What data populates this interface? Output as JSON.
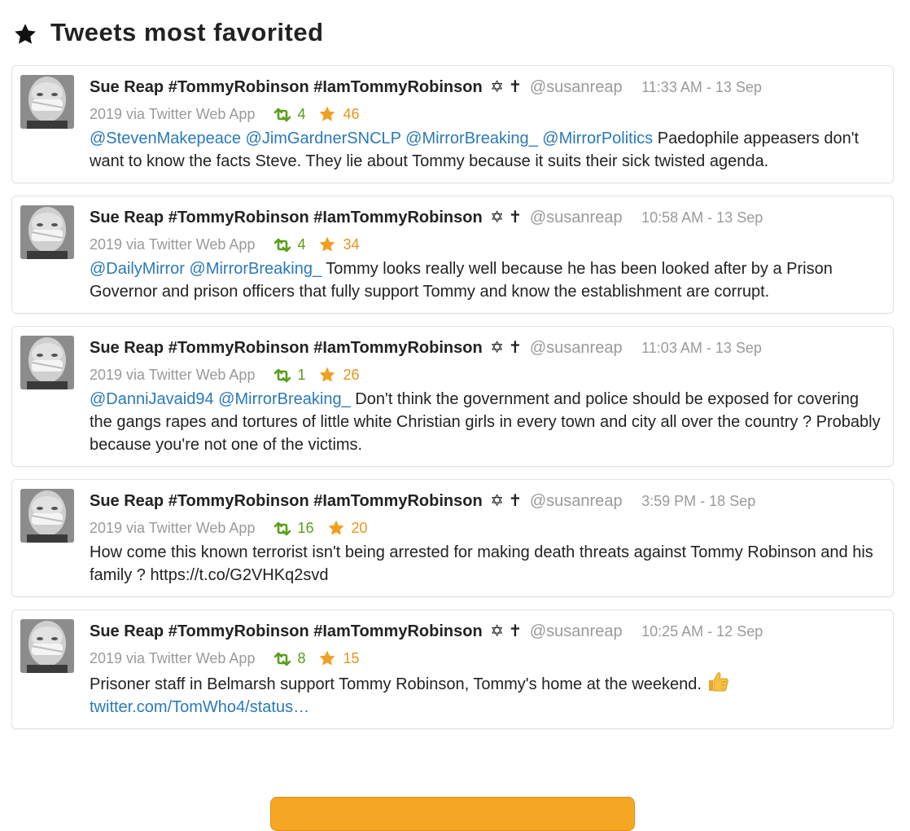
{
  "section": {
    "title": "Tweets most favorited",
    "icon": "star-icon"
  },
  "colors": {
    "text": "#222222",
    "muted": "#9a9a9a",
    "link": "#2a7ab8",
    "retweet": "#5a9e1b",
    "favorite": "#e8941a",
    "button": "#f5a623"
  },
  "tweets": [
    {
      "name": "Sue Reap #TommyRobinson #IamTommyRobinson",
      "symbols": "✡ ✝",
      "handle": "@susanreap",
      "time": "11:33 AM - 13 Sep",
      "date_cont": "2019 via Twitter Web App",
      "retweets": "4",
      "favorites": "46",
      "mentions": "@StevenMakepeace @JimGardnerSNCLP @MirrorBreaking_ @MirrorPolitics",
      "text": " Paedophile appeasers don't want to know the facts Steve. They lie about Tommy because it suits their sick twisted agenda.",
      "link": ""
    },
    {
      "name": "Sue Reap #TommyRobinson #IamTommyRobinson",
      "symbols": "✡ ✝",
      "handle": "@susanreap",
      "time": "10:58 AM - 13 Sep",
      "date_cont": "2019 via Twitter Web App",
      "retweets": "4",
      "favorites": "34",
      "mentions": "@DailyMirror @MirrorBreaking_",
      "text": " Tommy looks really well because he has been looked after by a Prison Governor and prison officers that fully support Tommy and know the establishment are corrupt.",
      "link": ""
    },
    {
      "name": "Sue Reap #TommyRobinson #IamTommyRobinson",
      "symbols": "✡ ✝",
      "handle": "@susanreap",
      "time": "11:03 AM - 13 Sep",
      "date_cont": "2019 via Twitter Web App",
      "retweets": "1",
      "favorites": "26",
      "mentions": "@DanniJavaid94 @MirrorBreaking_",
      "text": " Don't think the government and police should be exposed for covering the gangs rapes and tortures of little white Christian girls in every town and city all over the country ? Probably because you're not one of the victims.",
      "link": ""
    },
    {
      "name": "Sue Reap #TommyRobinson #IamTommyRobinson",
      "symbols": "✡ ✝",
      "handle": "@susanreap",
      "time": "3:59 PM - 18 Sep",
      "date_cont": "2019 via Twitter Web App",
      "retweets": "16",
      "favorites": "20",
      "mentions": "",
      "text": "How come this known terrorist isn't being arrested for making death threats against Tommy Robinson and his family ? https://t.co/G2VHKq2svd",
      "link": ""
    },
    {
      "name": "Sue Reap #TommyRobinson #IamTommyRobinson",
      "symbols": "✡ ✝",
      "handle": "@susanreap",
      "time": "10:25 AM - 12 Sep",
      "date_cont": "2019 via Twitter Web App",
      "retweets": "8",
      "favorites": "15",
      "mentions": "",
      "text": "Prisoner staff in Belmarsh support Tommy Robinson, Tommy's home at the weekend.",
      "emoji": "thumbs-up-icon",
      "link": "twitter.com/TomWho4/status…"
    }
  ]
}
